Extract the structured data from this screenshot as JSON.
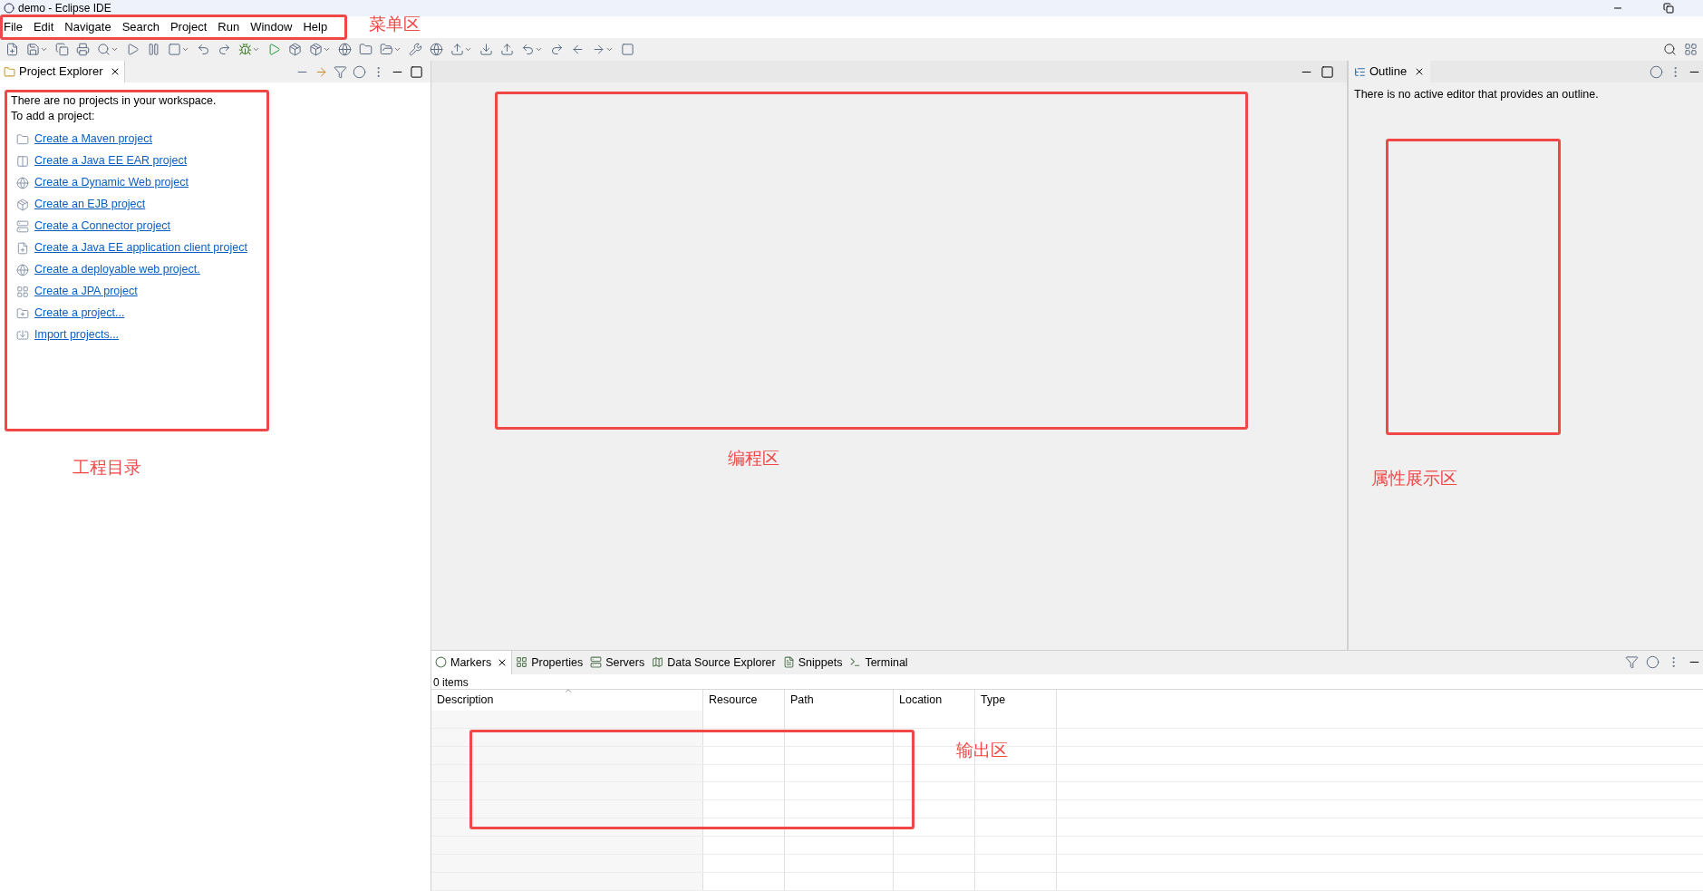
{
  "window": {
    "title": "demo - Eclipse IDE"
  },
  "menu": [
    "File",
    "Edit",
    "Navigate",
    "Search",
    "Project",
    "Run",
    "Window",
    "Help"
  ],
  "project_explorer": {
    "title": "Project Explorer",
    "intro": [
      "There are no projects in your workspace.",
      "To add a project:"
    ],
    "links": [
      "Create a Maven project",
      "Create a Java EE EAR project",
      "Create a Dynamic Web project",
      "Create an EJB project",
      "Create a Connector project",
      "Create a Java EE application client project",
      "Create a deployable web project.",
      "Create a JPA project",
      "Create a project...",
      "Import projects..."
    ]
  },
  "outline": {
    "title": "Outline",
    "message": "There is no active editor that provides an outline."
  },
  "bottom_tabs": [
    {
      "label": "Markers",
      "selected": true
    },
    {
      "label": "Properties",
      "selected": false
    },
    {
      "label": "Servers",
      "selected": false
    },
    {
      "label": "Data Source Explorer",
      "selected": false
    },
    {
      "label": "Snippets",
      "selected": false
    },
    {
      "label": "Terminal",
      "selected": false
    }
  ],
  "markers": {
    "count": "0 items",
    "columns": [
      "Description",
      "Resource",
      "Path",
      "Location",
      "Type"
    ]
  },
  "annotations": [
    "菜单区",
    "工程目录",
    "编程区",
    "属性展示区",
    "输出区"
  ]
}
